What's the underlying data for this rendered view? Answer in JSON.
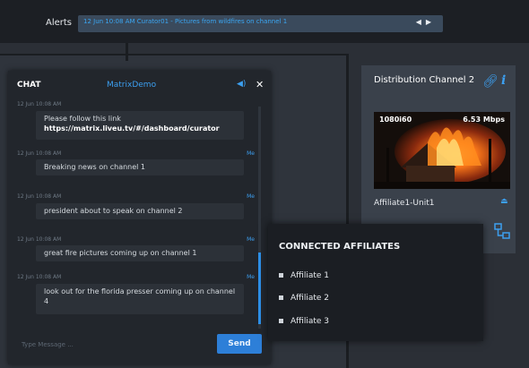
{
  "alerts": {
    "label": "Alerts",
    "message": "12 Jun 10:08 AM  Curator01 - Pictures from wildfires on channel 1",
    "nav_prev": "◀",
    "nav_next": "▶"
  },
  "chat": {
    "title": "CHAT",
    "room": "MatrixDemo",
    "messages": [
      {
        "time": "12 Jun 10:08 AM",
        "sender": "",
        "text": "Please follow this link",
        "link": "https://matrix.liveu.tv/#/dashboard/curator"
      },
      {
        "time": "12 Jun 10:08 AM",
        "sender": "Me",
        "text": "Breaking news on channel 1"
      },
      {
        "time": "12 Jun 10:08 AM",
        "sender": "Me",
        "text": "president about to speak on channel 2"
      },
      {
        "time": "12 Jun 10:08 AM",
        "sender": "Me",
        "text": "great fire pictures coming up on channel 1"
      },
      {
        "time": "12 Jun 10:08 AM",
        "sender": "Me",
        "text": "look out for the florida presser coming up on channel 4"
      }
    ],
    "input_placeholder": "Type Message ...",
    "send_label": "Send"
  },
  "distribution": {
    "title": "Distribution Channel 2",
    "resolution": "1080i60",
    "bitrate": "6.53 Mbps",
    "unit": "Affiliate1-Unit1"
  },
  "affiliates": {
    "title": "CONNECTED AFFILIATES",
    "items": [
      "Affiliate 1",
      "Affiliate 2",
      "Affiliate 3"
    ]
  },
  "colors": {
    "accent": "#3c9ff0",
    "send_button": "#2d7fd8",
    "background": "#2b2f36"
  },
  "icons": [
    "speaker-icon",
    "close-icon",
    "link-icon",
    "info-icon",
    "eject-icon",
    "network-icon",
    "chevron-left-icon",
    "chevron-right-icon"
  ]
}
